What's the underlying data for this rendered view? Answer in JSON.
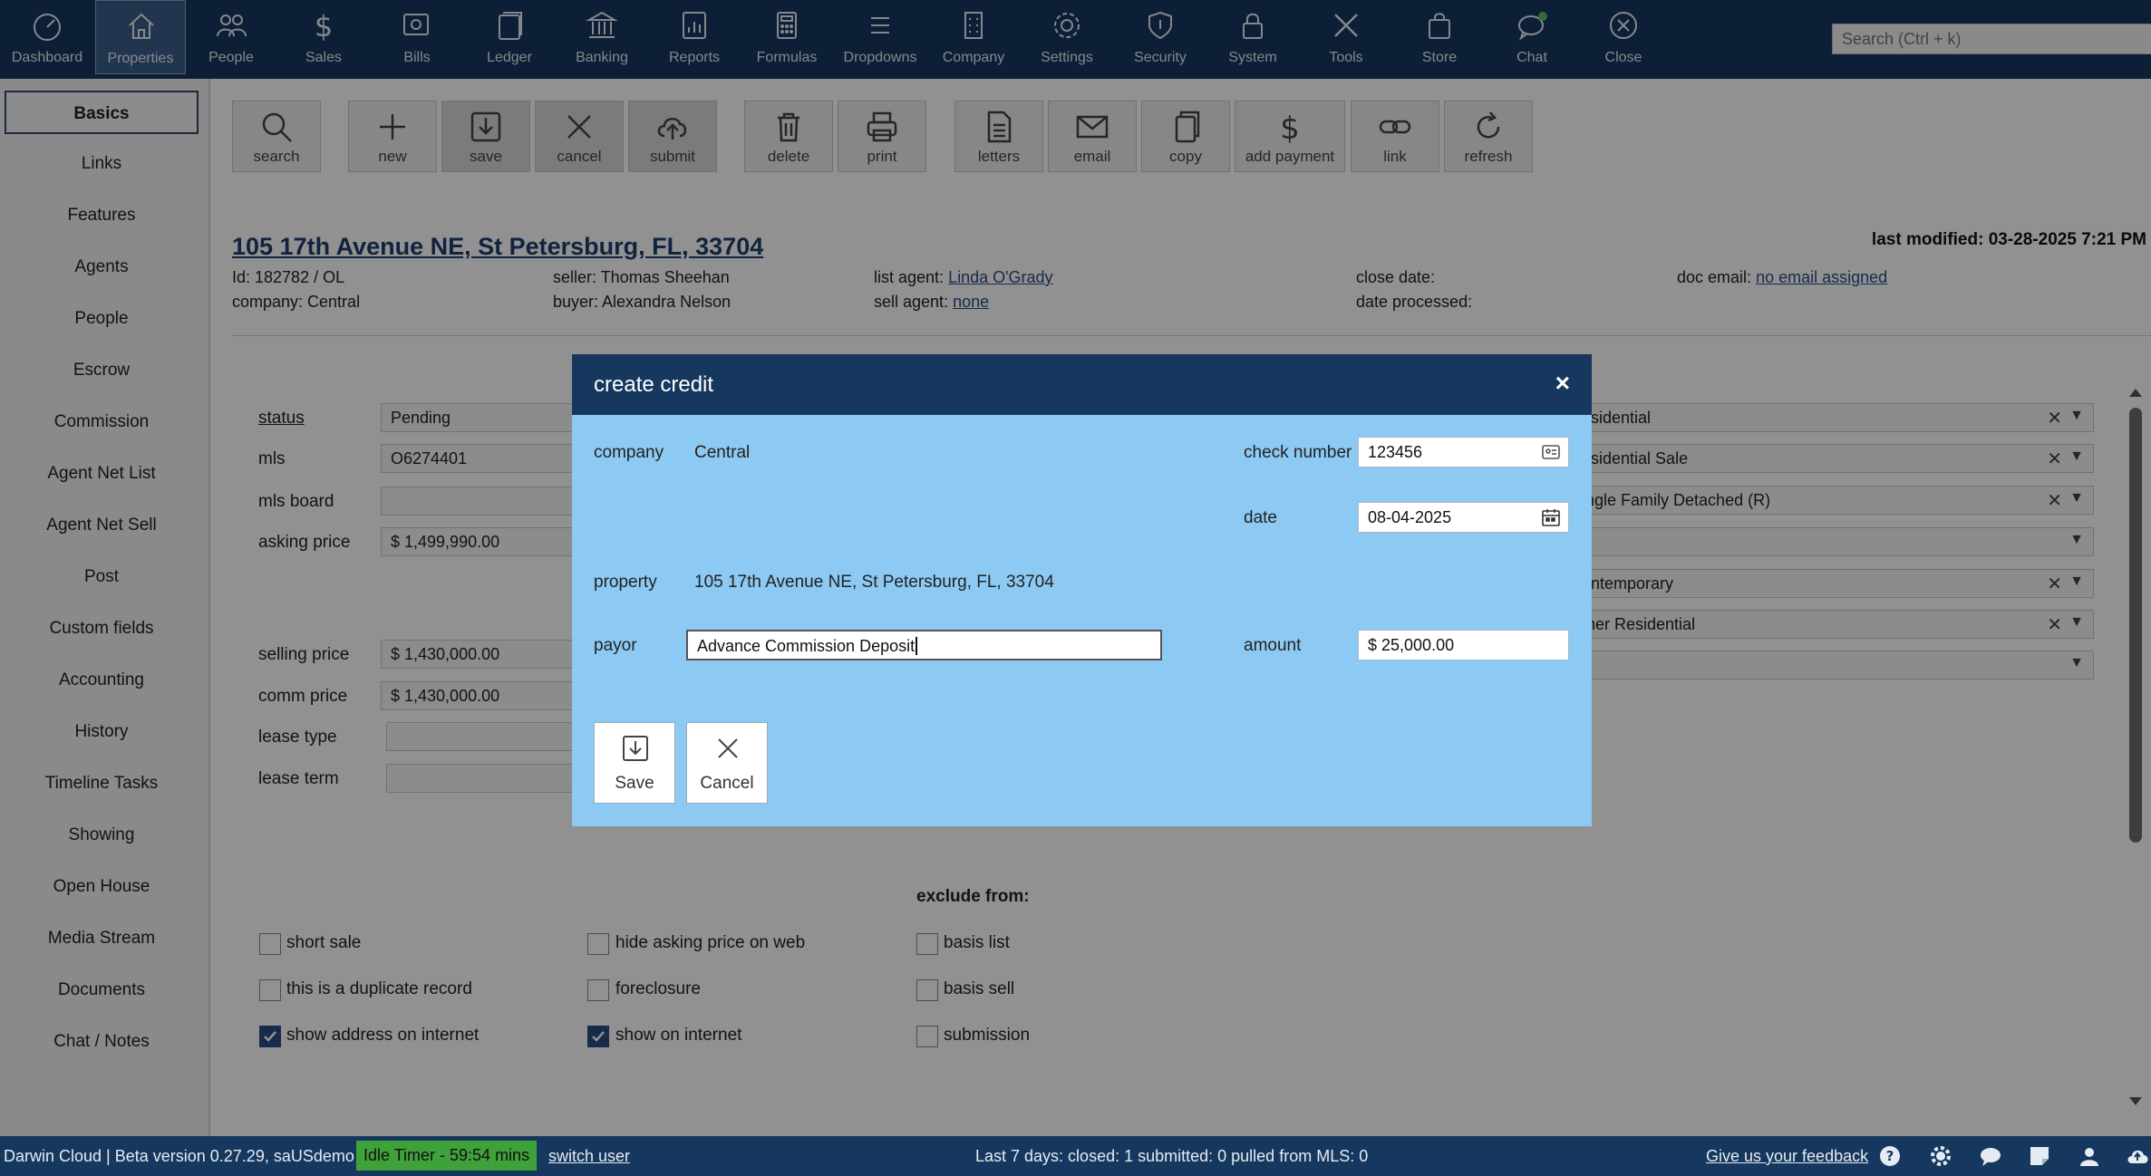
{
  "nav": {
    "items": [
      {
        "label": "Dashboard",
        "icon": "gauge-icon"
      },
      {
        "label": "Properties",
        "icon": "house-icon"
      },
      {
        "label": "People",
        "icon": "people-icon"
      },
      {
        "label": "Sales",
        "icon": "dollar-icon"
      },
      {
        "label": "Bills",
        "icon": "bills-icon"
      },
      {
        "label": "Ledger",
        "icon": "ledger-icon"
      },
      {
        "label": "Banking",
        "icon": "bank-icon"
      },
      {
        "label": "Reports",
        "icon": "report-icon"
      },
      {
        "label": "Formulas",
        "icon": "calculator-icon"
      },
      {
        "label": "Dropdowns",
        "icon": "list-icon"
      },
      {
        "label": "Company",
        "icon": "building-icon"
      },
      {
        "label": "Settings",
        "icon": "gear-icon"
      },
      {
        "label": "Security",
        "icon": "shield-icon"
      },
      {
        "label": "System",
        "icon": "lock-icon"
      },
      {
        "label": "Tools",
        "icon": "tools-icon"
      },
      {
        "label": "Store",
        "icon": "bag-icon"
      },
      {
        "label": "Chat",
        "icon": "chat-icon"
      },
      {
        "label": "Close",
        "icon": "close-circle-icon"
      }
    ],
    "active": "Properties",
    "search_placeholder": "Search (Ctrl + k)"
  },
  "sidebar": {
    "items": [
      "Basics",
      "Links",
      "Features",
      "Agents",
      "People",
      "Escrow",
      "Commission",
      "Agent Net List",
      "Agent Net Sell",
      "Post",
      "Custom fields",
      "Accounting",
      "History",
      "Timeline Tasks",
      "Showing",
      "Open House",
      "Media Stream",
      "Documents",
      "Chat / Notes"
    ],
    "active": "Basics"
  },
  "toolbar": {
    "buttons": [
      {
        "label": "search",
        "icon": "search-icon"
      },
      {
        "label": "new",
        "icon": "plus-icon"
      },
      {
        "label": "save",
        "icon": "save-icon"
      },
      {
        "label": "cancel",
        "icon": "x-icon"
      },
      {
        "label": "submit",
        "icon": "cloud-upload-icon"
      },
      {
        "label": "delete",
        "icon": "trash-icon"
      },
      {
        "label": "print",
        "icon": "printer-icon"
      },
      {
        "label": "letters",
        "icon": "document-icon"
      },
      {
        "label": "email",
        "icon": "envelope-icon"
      },
      {
        "label": "copy",
        "icon": "copy-icon"
      },
      {
        "label": "add payment",
        "icon": "dollar-icon"
      },
      {
        "label": "link",
        "icon": "link-icon"
      },
      {
        "label": "refresh",
        "icon": "refresh-icon"
      }
    ]
  },
  "property": {
    "address": "105 17th Avenue NE, St Petersburg, FL, 33704",
    "last_modified": "last modified: 03-28-2025 7:21 PM",
    "id": "Id: 182782 / OL",
    "company": "company: Central",
    "seller": "seller: Thomas Sheehan",
    "buyer": "buyer: Alexandra Nelson",
    "list_agent_label": "list agent:",
    "list_agent": "Linda O'Grady",
    "sell_agent_label": "sell agent:",
    "sell_agent": "none",
    "close_date": "close date:",
    "date_processed": "date processed:",
    "doc_email_label": "doc email:",
    "doc_email": "no email assigned"
  },
  "form": {
    "status_label": "status",
    "status_value": "Pending",
    "mls_label": "mls",
    "mls_value": "O6274401",
    "mls_board_label": "mls board",
    "asking_price_label": "asking price",
    "asking_price": "$ 1,499,990.00",
    "selling_price_label": "selling price",
    "selling_price": "$ 1,430,000.00",
    "comm_price_label": "comm price",
    "comm_price": "$ 1,430,000.00",
    "lease_type_label": "lease type",
    "lease_term_label": "lease term",
    "right_fields": [
      "esidential",
      "esidential Sale",
      "ingle Family Detached (R)",
      "",
      "ontemporary",
      "ther Residential",
      ""
    ],
    "exclude_from": "exclude from:",
    "checkboxes": [
      {
        "label": "short sale",
        "checked": false
      },
      {
        "label": "this is a duplicate record",
        "checked": false
      },
      {
        "label": "show address on internet",
        "checked": true
      },
      {
        "label": "hide asking price on web",
        "checked": false
      },
      {
        "label": "foreclosure",
        "checked": false
      },
      {
        "label": "show on internet",
        "checked": true
      },
      {
        "label": "basis list",
        "checked": false
      },
      {
        "label": "basis sell",
        "checked": false
      },
      {
        "label": "submission",
        "checked": false
      }
    ]
  },
  "modal": {
    "title": "create credit",
    "close": "×",
    "company_label": "company",
    "company_value": "Central",
    "property_label": "property",
    "property_value": "105 17th Avenue NE, St Petersburg, FL, 33704",
    "payor_label": "payor",
    "payor_value": "Advance Commission Deposit",
    "check_number_label": "check number",
    "check_number_value": "123456",
    "date_label": "date",
    "date_value": "08-04-2025",
    "amount_label": "amount",
    "amount_value": "$ 25,000.00",
    "save_label": "Save",
    "cancel_label": "Cancel"
  },
  "status": {
    "version": "Darwin Cloud | Beta version 0.27.29, saUSdemo",
    "idle_timer": "Idle Timer - 59:54 mins",
    "switch_user": "switch user",
    "stats": "Last 7 days: closed: 1 submitted: 0 pulled from MLS: 0",
    "feedback": "Give us your feedback"
  },
  "colors": {
    "nav_bg": "#16385f",
    "modal_bg": "#8ccaf3",
    "idle_green": "#3fa13a",
    "link": "#2a4d88"
  }
}
